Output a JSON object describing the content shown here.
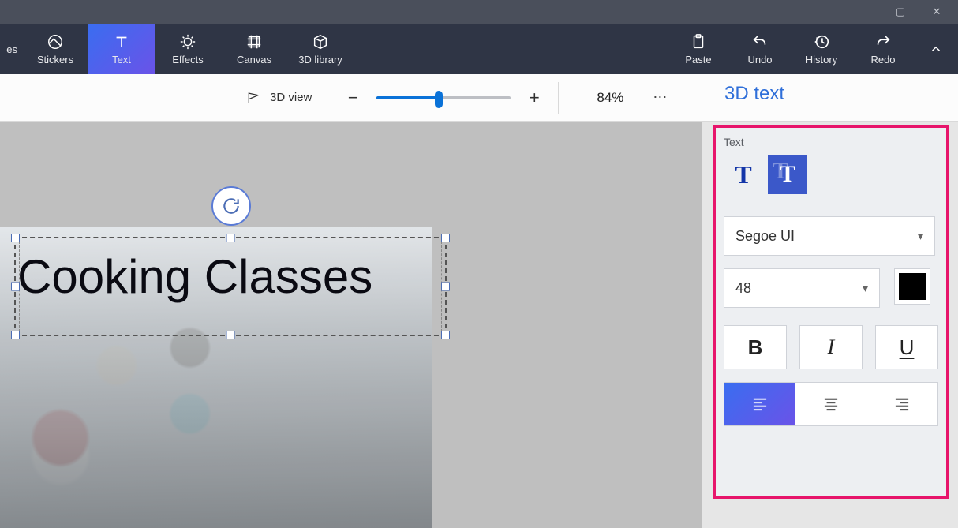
{
  "titlebar": {
    "min": "—",
    "max": "▢",
    "close": "✕"
  },
  "ribbon": {
    "items": [
      {
        "label": "es"
      },
      {
        "label": "Stickers"
      },
      {
        "label": "Text"
      },
      {
        "label": "Effects"
      },
      {
        "label": "Canvas"
      },
      {
        "label": "3D library"
      }
    ],
    "right": [
      {
        "label": "Paste"
      },
      {
        "label": "Undo"
      },
      {
        "label": "History"
      },
      {
        "label": "Redo"
      }
    ]
  },
  "toolbar": {
    "view3d": "3D view",
    "minus": "−",
    "plus": "+",
    "zoom": "84%",
    "more": "⋯"
  },
  "side_title": "3D text",
  "panel": {
    "section_label": "Text",
    "font": "Segoe UI",
    "size": "48",
    "bold": "B",
    "italic": "I",
    "underline": "U"
  },
  "canvas": {
    "text": "Cooking Classes"
  }
}
